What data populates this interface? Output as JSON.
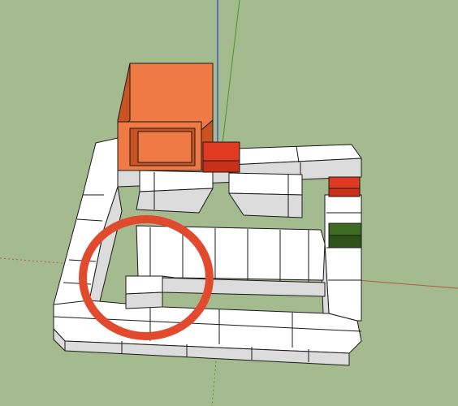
{
  "viewport": {
    "background": "#a3bb8e",
    "axes": {
      "blue": "#2a3fd6",
      "green": "#3f9a2c",
      "red": "#b55a4a"
    }
  },
  "model": {
    "colors": {
      "white": "#ffffff",
      "shade": "#dcdcdc",
      "edge": "#1a1a1a",
      "orange_front": "#ef7a45",
      "orange_side": "#c95422",
      "red": "#e03a22",
      "dark_green": "#3d6b22"
    }
  },
  "annotation": {
    "shape": "circle",
    "color": "#e14a2c"
  }
}
